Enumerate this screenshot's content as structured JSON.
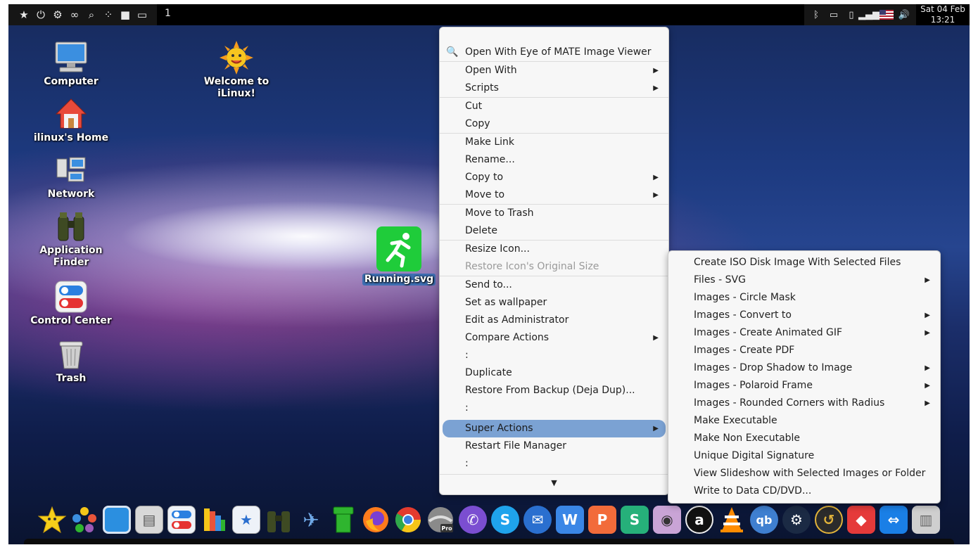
{
  "top_panel": {
    "workspace": "1",
    "clock_date": "Sat 04 Feb",
    "clock_time": "13:21",
    "left_icons": [
      "favorites-icon",
      "power-icon",
      "settings-icon",
      "binoculars-icon",
      "search-icon",
      "apps-icon",
      "folder-icon",
      "window-icon"
    ],
    "tray_icons": [
      "bluetooth-icon",
      "battery-icon",
      "clipboard-icon",
      "signal-icon",
      "flag-icon",
      "volume-icon"
    ]
  },
  "desktop": {
    "icons": [
      {
        "label": "Computer",
        "icon": "computer-icon"
      },
      {
        "label": "ilinux's Home",
        "icon": "home-icon"
      },
      {
        "label": "Network",
        "icon": "network-icon"
      },
      {
        "label": "Application Finder",
        "icon": "binoculars-icon"
      },
      {
        "label": "Control Center",
        "icon": "toggle-icon"
      },
      {
        "label": "Trash",
        "icon": "trash-icon"
      },
      {
        "label": "Welcome to iLinux!",
        "icon": "sun-icon"
      }
    ],
    "selected_file": {
      "label": "Running.svg",
      "icon": "running-icon",
      "color": "#1fcc3a"
    }
  },
  "context_menu": {
    "items": {
      "open_eom": "Open With Eye of MATE Image Viewer",
      "open_with": "Open With",
      "scripts": "Scripts",
      "cut": "Cut",
      "copy": "Copy",
      "make_link": "Make Link",
      "rename": "Rename...",
      "copy_to": "Copy to",
      "move_to": "Move to",
      "move_to_trash": "Move to Trash",
      "delete": "Delete",
      "resize_icon": "Resize Icon...",
      "restore_icon_size": "Restore Icon's Original Size",
      "send_to": "Send to...",
      "set_wallpaper": "Set as wallpaper",
      "edit_admin": "Edit as Administrator",
      "compare_actions": "Compare Actions",
      "colon1": ":",
      "duplicate": "Duplicate",
      "restore_backup": "Restore From Backup (Deja Dup)...",
      "colon2": ":",
      "super_actions": "Super Actions",
      "restart_fm": "Restart File Manager",
      "colon3": ":"
    },
    "highlight_color": "#7ba2d3"
  },
  "submenu": {
    "items": [
      {
        "label": "Create ISO Disk Image With Selected Files",
        "has_sub": false
      },
      {
        "label": "Files - SVG",
        "has_sub": true
      },
      {
        "label": "Images - Circle Mask",
        "has_sub": false
      },
      {
        "label": "Images - Convert to",
        "has_sub": true
      },
      {
        "label": "Images - Create Animated GIF",
        "has_sub": true
      },
      {
        "label": "Images - Create PDF",
        "has_sub": false
      },
      {
        "label": "Images - Drop Shadow to Image",
        "has_sub": true
      },
      {
        "label": "Images - Polaroid Frame",
        "has_sub": true
      },
      {
        "label": "Images - Rounded Corners with Radius",
        "has_sub": true
      },
      {
        "label": "Make Executable",
        "has_sub": false
      },
      {
        "label": "Make Non Executable",
        "has_sub": false
      },
      {
        "label": "Unique Digital Signature",
        "has_sub": false
      },
      {
        "label": "View Slideshow with Selected Images or Folder",
        "has_sub": false
      },
      {
        "label": "Write to Data CD/DVD...",
        "has_sub": false
      }
    ]
  },
  "dock": {
    "apps": [
      {
        "name": "star-icon",
        "color": "#f5c518",
        "glyph": "★"
      },
      {
        "name": "dots-icon",
        "color": "#ffffff00",
        "glyph": "⁂"
      },
      {
        "name": "desktop-icon",
        "color": "#2b8fe0",
        "glyph": ""
      },
      {
        "name": "cabinet-icon",
        "color": "#cfcfcf",
        "glyph": "▤"
      },
      {
        "name": "toggle-icon",
        "color": "#e8eef7",
        "glyph": ""
      },
      {
        "name": "palette-icon",
        "color": "#f2d28a",
        "glyph": "▥"
      },
      {
        "name": "bag-icon",
        "color": "#e9eef4",
        "glyph": "★"
      },
      {
        "name": "binoculars-icon",
        "color": "#3a4a22",
        "glyph": "∞"
      },
      {
        "name": "plane-icon",
        "color": "#ffffff00",
        "glyph": "✈"
      },
      {
        "name": "pipe-icon",
        "color": "#2fb52f",
        "glyph": ""
      },
      {
        "name": "firefox-icon",
        "color": "#ff7b1c",
        "glyph": ""
      },
      {
        "name": "chrome-icon",
        "color": "#e33b2e",
        "glyph": ""
      },
      {
        "name": "earth-pro-icon",
        "color": "#9a9a9a",
        "glyph": ""
      },
      {
        "name": "viber-icon",
        "color": "#7b4ed1",
        "glyph": "✆"
      },
      {
        "name": "skype-icon",
        "color": "#1fa3ec",
        "glyph": "S"
      },
      {
        "name": "mail-icon",
        "color": "#2a6fcf",
        "glyph": "✉"
      },
      {
        "name": "writer-icon",
        "color": "#3a86e6",
        "glyph": "W"
      },
      {
        "name": "presentation-icon",
        "color": "#f26b3a",
        "glyph": "P"
      },
      {
        "name": "spreadsheet-icon",
        "color": "#26b07a",
        "glyph": "S"
      },
      {
        "name": "webcam-icon",
        "color": "#c9a4d6",
        "glyph": "◉"
      },
      {
        "name": "amazon-icon",
        "color": "#111111",
        "glyph": "a"
      },
      {
        "name": "vlc-icon",
        "color": "#ffffff00",
        "glyph": "▲"
      },
      {
        "name": "qbittorrent-icon",
        "color": "#3f7fd0",
        "glyph": "qb"
      },
      {
        "name": "steam-icon",
        "color": "#1b2a44",
        "glyph": "⚙"
      },
      {
        "name": "backup-icon",
        "color": "#e2b33a",
        "glyph": "↺"
      },
      {
        "name": "anydesk-icon",
        "color": "#e53a3a",
        "glyph": "◆"
      },
      {
        "name": "teamviewer-icon",
        "color": "#1a7fe6",
        "glyph": "⇔"
      },
      {
        "name": "trash-icon",
        "color": "#bdbdbd",
        "glyph": "▥"
      }
    ]
  }
}
